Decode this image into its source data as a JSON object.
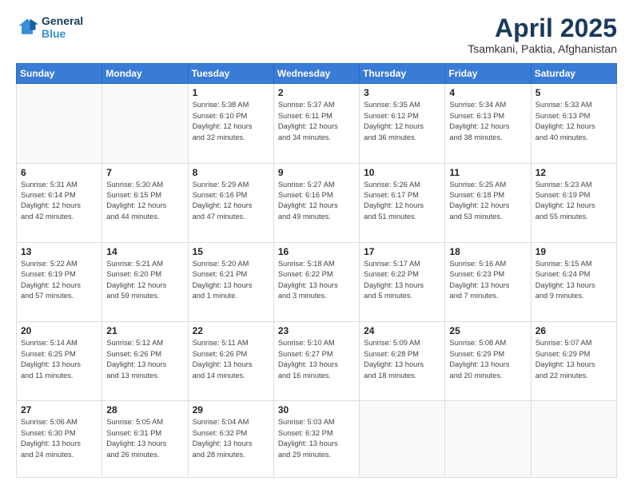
{
  "logo": {
    "line1": "General",
    "line2": "Blue"
  },
  "title": "April 2025",
  "subtitle": "Tsamkani, Paktia, Afghanistan",
  "days_header": [
    "Sunday",
    "Monday",
    "Tuesday",
    "Wednesday",
    "Thursday",
    "Friday",
    "Saturday"
  ],
  "weeks": [
    [
      {
        "num": "",
        "info": ""
      },
      {
        "num": "",
        "info": ""
      },
      {
        "num": "1",
        "info": "Sunrise: 5:38 AM\nSunset: 6:10 PM\nDaylight: 12 hours\nand 32 minutes."
      },
      {
        "num": "2",
        "info": "Sunrise: 5:37 AM\nSunset: 6:11 PM\nDaylight: 12 hours\nand 34 minutes."
      },
      {
        "num": "3",
        "info": "Sunrise: 5:35 AM\nSunset: 6:12 PM\nDaylight: 12 hours\nand 36 minutes."
      },
      {
        "num": "4",
        "info": "Sunrise: 5:34 AM\nSunset: 6:13 PM\nDaylight: 12 hours\nand 38 minutes."
      },
      {
        "num": "5",
        "info": "Sunrise: 5:33 AM\nSunset: 6:13 PM\nDaylight: 12 hours\nand 40 minutes."
      }
    ],
    [
      {
        "num": "6",
        "info": "Sunrise: 5:31 AM\nSunset: 6:14 PM\nDaylight: 12 hours\nand 42 minutes."
      },
      {
        "num": "7",
        "info": "Sunrise: 5:30 AM\nSunset: 6:15 PM\nDaylight: 12 hours\nand 44 minutes."
      },
      {
        "num": "8",
        "info": "Sunrise: 5:29 AM\nSunset: 6:16 PM\nDaylight: 12 hours\nand 47 minutes."
      },
      {
        "num": "9",
        "info": "Sunrise: 5:27 AM\nSunset: 6:16 PM\nDaylight: 12 hours\nand 49 minutes."
      },
      {
        "num": "10",
        "info": "Sunrise: 5:26 AM\nSunset: 6:17 PM\nDaylight: 12 hours\nand 51 minutes."
      },
      {
        "num": "11",
        "info": "Sunrise: 5:25 AM\nSunset: 6:18 PM\nDaylight: 12 hours\nand 53 minutes."
      },
      {
        "num": "12",
        "info": "Sunrise: 5:23 AM\nSunset: 6:19 PM\nDaylight: 12 hours\nand 55 minutes."
      }
    ],
    [
      {
        "num": "13",
        "info": "Sunrise: 5:22 AM\nSunset: 6:19 PM\nDaylight: 12 hours\nand 57 minutes."
      },
      {
        "num": "14",
        "info": "Sunrise: 5:21 AM\nSunset: 6:20 PM\nDaylight: 12 hours\nand 59 minutes."
      },
      {
        "num": "15",
        "info": "Sunrise: 5:20 AM\nSunset: 6:21 PM\nDaylight: 13 hours\nand 1 minute."
      },
      {
        "num": "16",
        "info": "Sunrise: 5:18 AM\nSunset: 6:22 PM\nDaylight: 13 hours\nand 3 minutes."
      },
      {
        "num": "17",
        "info": "Sunrise: 5:17 AM\nSunset: 6:22 PM\nDaylight: 13 hours\nand 5 minutes."
      },
      {
        "num": "18",
        "info": "Sunrise: 5:16 AM\nSunset: 6:23 PM\nDaylight: 13 hours\nand 7 minutes."
      },
      {
        "num": "19",
        "info": "Sunrise: 5:15 AM\nSunset: 6:24 PM\nDaylight: 13 hours\nand 9 minutes."
      }
    ],
    [
      {
        "num": "20",
        "info": "Sunrise: 5:14 AM\nSunset: 6:25 PM\nDaylight: 13 hours\nand 11 minutes."
      },
      {
        "num": "21",
        "info": "Sunrise: 5:12 AM\nSunset: 6:26 PM\nDaylight: 13 hours\nand 13 minutes."
      },
      {
        "num": "22",
        "info": "Sunrise: 5:11 AM\nSunset: 6:26 PM\nDaylight: 13 hours\nand 14 minutes."
      },
      {
        "num": "23",
        "info": "Sunrise: 5:10 AM\nSunset: 6:27 PM\nDaylight: 13 hours\nand 16 minutes."
      },
      {
        "num": "24",
        "info": "Sunrise: 5:09 AM\nSunset: 6:28 PM\nDaylight: 13 hours\nand 18 minutes."
      },
      {
        "num": "25",
        "info": "Sunrise: 5:08 AM\nSunset: 6:29 PM\nDaylight: 13 hours\nand 20 minutes."
      },
      {
        "num": "26",
        "info": "Sunrise: 5:07 AM\nSunset: 6:29 PM\nDaylight: 13 hours\nand 22 minutes."
      }
    ],
    [
      {
        "num": "27",
        "info": "Sunrise: 5:06 AM\nSunset: 6:30 PM\nDaylight: 13 hours\nand 24 minutes."
      },
      {
        "num": "28",
        "info": "Sunrise: 5:05 AM\nSunset: 6:31 PM\nDaylight: 13 hours\nand 26 minutes."
      },
      {
        "num": "29",
        "info": "Sunrise: 5:04 AM\nSunset: 6:32 PM\nDaylight: 13 hours\nand 28 minutes."
      },
      {
        "num": "30",
        "info": "Sunrise: 5:03 AM\nSunset: 6:32 PM\nDaylight: 13 hours\nand 29 minutes."
      },
      {
        "num": "",
        "info": ""
      },
      {
        "num": "",
        "info": ""
      },
      {
        "num": "",
        "info": ""
      }
    ]
  ]
}
